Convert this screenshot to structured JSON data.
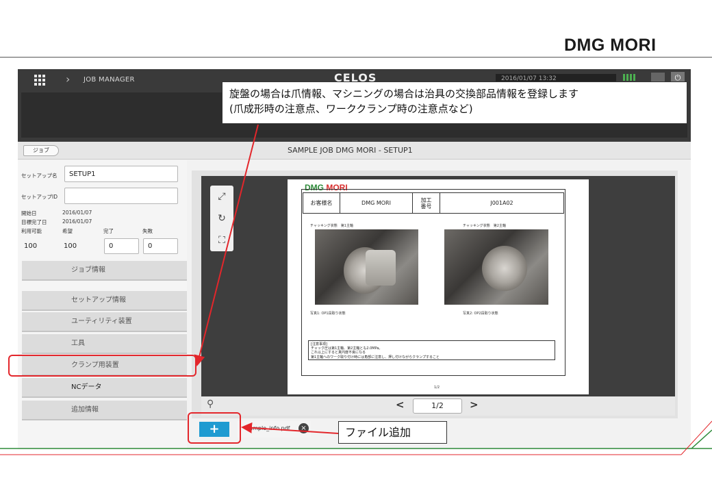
{
  "brand": "DMG MORI",
  "app": {
    "breadcrumb": "JOB MANAGER",
    "title": "CELOS",
    "datetime": "2016/01/07   13:32",
    "back_label": "ジョブ",
    "job_title": "SAMPLE JOB DMG MORI - SETUP1"
  },
  "setup": {
    "name_label": "セットアップ名",
    "name_value": "SETUP1",
    "id_label": "セットアップID",
    "id_value": "",
    "start_label": "開始日",
    "start_value": "2016/01/07",
    "target_label": "目標完了日",
    "target_value": "2016/01/07",
    "available_label": "利用可能",
    "desired_label": "希望",
    "done_label": "完了",
    "failed_label": "失敗",
    "available_value": "100",
    "desired_value": "100",
    "done_value": "0",
    "failed_value": "0"
  },
  "menu": [
    {
      "label": "ジョブ情報"
    },
    {
      "label": "セットアップ情報"
    },
    {
      "label": "ユーティリティ装置"
    },
    {
      "label": "工具"
    },
    {
      "label": "クランプ用装置"
    },
    {
      "label": "NCデータ"
    },
    {
      "label": "追加情報"
    }
  ],
  "document": {
    "logo_dmg": "DMG",
    "logo_mori": "MORI",
    "customer_label": "お客様名",
    "customer_value": "DMG MORI",
    "process_label_1": "加工",
    "process_label_2": "番号",
    "process_value": "J001A02",
    "caption_spindle1": "チャッキング状態　第1主軸",
    "caption_spindle2": "チャッキング状態　第2主軸",
    "photo1_caption": "写真1: OP1段取り状態",
    "photo2_caption": "写真2: OP2段取り状態",
    "notes_title": "[注意事項]",
    "notes_line1": "チャック圧は第1主軸、第2主軸とも2.0MPa。",
    "notes_line2": "これ以上にすると真円度不良になる",
    "notes_line3": "第1主軸へのワーク取り付け時には角部に注意し、押し付けながらクランプすること",
    "page_footer": "1/2"
  },
  "viewer": {
    "page_indicator": "1/2",
    "file_name": "sample_info.pdf"
  },
  "annotations": {
    "callout_line1": "旋盤の場合は爪情報、マシニングの場合は治具の交換部品情報を登録します",
    "callout_line2": "(爪成形時の注意点、ワーククランプ時の注意点など)",
    "add_file_label": "ファイル追加"
  },
  "colors": {
    "highlight": "#e3262b",
    "add_button": "#1f9bd1",
    "brand_green": "#2e8b3a",
    "brand_red": "#d82d2d"
  }
}
